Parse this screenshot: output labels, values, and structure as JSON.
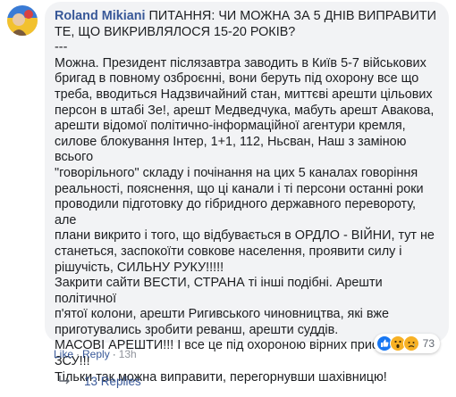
{
  "comment": {
    "author": "Roland Mikiani",
    "lines": [
      "ПИТАННЯ: ЧИ МОЖНА ЗА 5 ДНІВ ВИПРАВИТИ",
      "ТЕ, ЩО ВИКРИВЛЯЛОСЯ 15-20 РОКІВ?",
      "---",
      "Можна. Президент післязавтра заводить в Київ 5-7 військових",
      "бригад в повному озброєнні, вони беруть під охорону все що",
      "треба, вводиться Надзвичайний стан, миттєві арешти цільових",
      "персон в штабі Зе!, арешт Медведчука, мабуть арешт Авакова,",
      "арешти відомої політично-інформаційної агентури кремля,",
      "силове блокування Інтер, 1+1, 112, Ньсван, Наш з заміною всього",
      "\"говорільного\" складу і почінання на цих 5 каналах говоріння",
      "реальності, пояснення, що ці канали і ті персони останні роки",
      "проводили підготовку до гібридного державного перевороту, але",
      "плани викрито і того, що відбувається в ОРДЛО - ВІЙНИ, тут не",
      "станеться, заспокоїти совкове населення, проявити силу і",
      "рішучість, СИЛЬНУ РУКУ!!!!!",
      "Закрити сайти ВЕСТИ, СТРАНА ті інші подібні. Арешти політичної",
      "п'ятої колони, арешти Ригивського чиновництва, які вже",
      "приготувались зробити реванш, арешти суддів.",
      "МАСОВІ АРЕШТИ!!! І все це під охороною вірних присязі частин",
      "ЗСУ!!!",
      "Тільки так можна виправити, перегорнувши шахівницю!"
    ],
    "reactions": {
      "count": "73",
      "icons": [
        "like-icon",
        "wow-icon",
        "sad-icon"
      ]
    }
  },
  "actions": {
    "like": "Like",
    "reply": "Reply",
    "time": "13h",
    "sep": "·"
  },
  "replies": {
    "label": "13 Replies",
    "icon": "reply-arrow-icon"
  },
  "colors": {
    "link": "#385898",
    "bubble": "#f2f3f5",
    "text": "#1c1e21",
    "muted": "#90949c"
  }
}
